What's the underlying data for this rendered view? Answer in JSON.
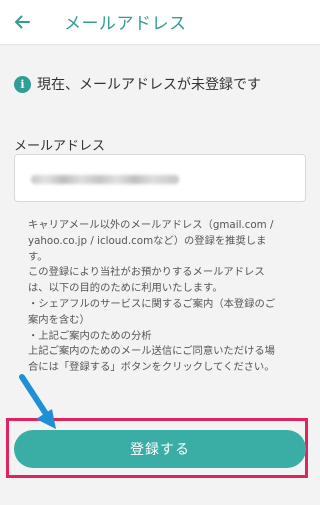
{
  "header": {
    "title": "メールアドレス",
    "back_icon": "arrow-left-icon"
  },
  "notice": {
    "icon": "info-icon",
    "icon_glyph": "i",
    "text": "現在、メールアドレスが未登録です"
  },
  "email": {
    "label": "メールアドレス",
    "value": "(blurred / obscured)"
  },
  "description": {
    "lines": [
      "キャリアメール以外のメールアドレス（gmail.com /",
      "yahoo.co.jp / icloud.comなど）の登録を推奨しま",
      "す。",
      "この登録により当社がお預かりするメールアドレス",
      "は、以下の目的のために利用いたします。",
      "・シェアフルのサービスに関するご案内（本登録のご",
      "案内を含む）",
      "・上記ご案内のための分析",
      "上記ご案内のためのメール送信にご同意いただける場",
      "合には「登録する」ボタンをクリックしてください。"
    ]
  },
  "register_button": {
    "label": "登録する"
  },
  "colors": {
    "accent": "#2f9e96",
    "button": "#3aaea5",
    "highlight": "#e0245e",
    "arrow": "#1f8fd6"
  }
}
